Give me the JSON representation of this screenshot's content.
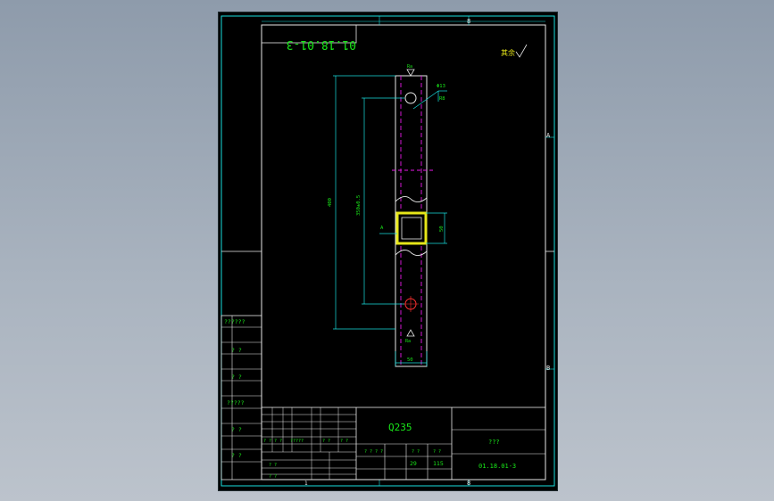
{
  "drawing": {
    "code_mirrored": "01.18.01-3",
    "material": "Q235",
    "title_cell": "???",
    "part_number": "01.18.01-3",
    "roughness_label": "其余",
    "scale_label": "?.?.?",
    "count": "29",
    "weight": "115",
    "sheet_labels": {
      "top_mid": "8",
      "right_a": "A",
      "right_b": "B",
      "bottom_1": "1",
      "bottom_8": "8"
    }
  },
  "side_table": {
    "rows": [
      "??????",
      "? ?",
      "? ?",
      "?????",
      "? ?",
      "? ?"
    ]
  },
  "title_block": {
    "left_rows": [
      "? ?",
      "? ?",
      "?????",
      "? ?",
      "? ?"
    ],
    "lower_left": [
      "? ?",
      "? ?"
    ],
    "mid_small": [
      "? ? ? ?",
      "? ?",
      "? ?"
    ]
  },
  "dimensions": {
    "hole": "Φ13",
    "hole_depth": "R8",
    "overall_height": "400",
    "inner_height": "350±0.5",
    "section_w": "50",
    "width": "50",
    "section_label": "A",
    "top_finish": "Ra",
    "bottom_finish": "Ra"
  },
  "colors": {
    "frame": "#19dede",
    "text": "#19e619",
    "part": "#e8e8e8",
    "hidden": "#e619e6",
    "hole": "#ff3030"
  }
}
